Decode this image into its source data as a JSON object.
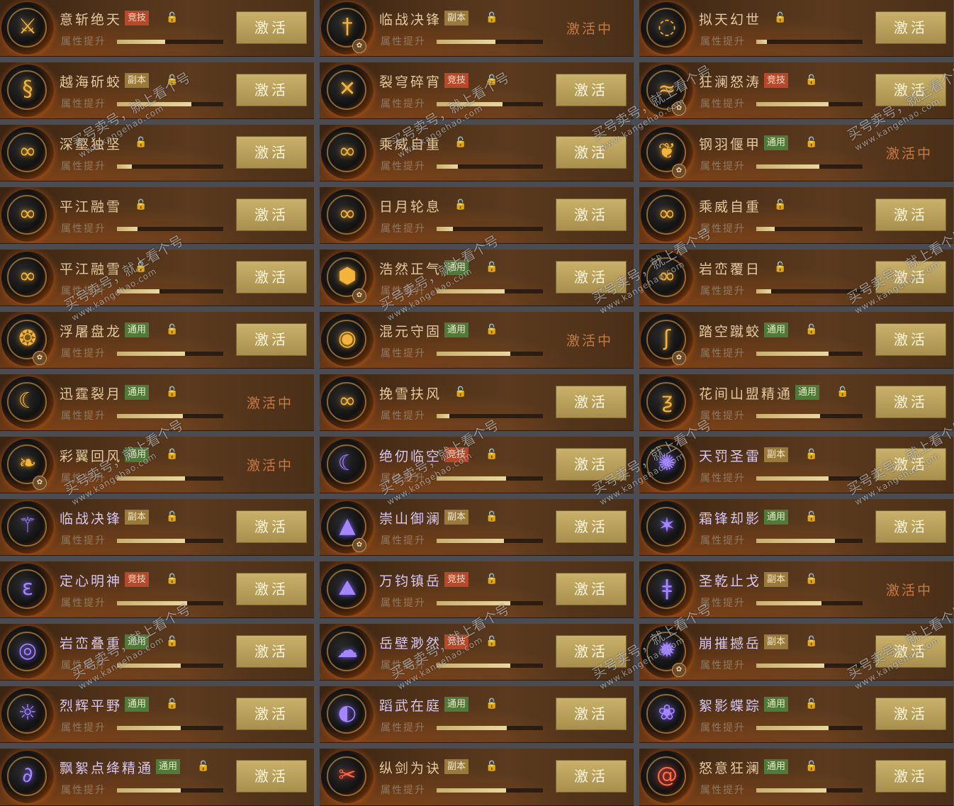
{
  "ui": {
    "attr_label": "属性提升",
    "activate_label": "激活",
    "active_label": "激活中",
    "tags": {
      "jingji": "竞技",
      "fuben": "副本",
      "tongyong": "通用"
    }
  },
  "watermark": {
    "line1": "买号卖号，就上看个号",
    "line2": "www.kangehao.com"
  },
  "rows": [
    [
      {
        "name": "意斩绝天",
        "tag": "竞技",
        "lock": true,
        "progress": 0.45,
        "state": "activate",
        "icon": "flame-sword-icon",
        "tone": "gold",
        "seal": false
      },
      {
        "name": "临战决锋",
        "tag": "副本",
        "lock": true,
        "progress": 0.55,
        "state": "active",
        "icon": "sword-hilt-icon",
        "tone": "gold",
        "seal": true
      },
      {
        "name": "拟天幻世",
        "tag": "",
        "lock": true,
        "progress": 0.1,
        "state": "activate",
        "icon": "orb-chain-icon",
        "tone": "gold",
        "seal": false
      }
    ],
    [
      {
        "name": "越海斫蛟",
        "tag": "副本",
        "lock": true,
        "progress": 0.7,
        "state": "activate",
        "icon": "dragon-icon",
        "tone": "gold",
        "seal": false
      },
      {
        "name": "裂穹碎宵",
        "tag": "竞技",
        "lock": true,
        "progress": 0.62,
        "state": "activate",
        "icon": "crossed-blades-icon",
        "tone": "gold",
        "seal": false
      },
      {
        "name": "狂澜怒涛",
        "tag": "竞技",
        "lock": true,
        "progress": 0.68,
        "state": "activate",
        "icon": "wave-icon",
        "tone": "gold",
        "seal": true
      }
    ],
    [
      {
        "name": "深壑独坚",
        "tag": "",
        "lock": true,
        "progress": 0.14,
        "state": "activate",
        "icon": "chain-icon",
        "tone": "gold",
        "seal": false
      },
      {
        "name": "乘威自重",
        "tag": "",
        "lock": true,
        "progress": 0.2,
        "state": "activate",
        "icon": "chain-icon",
        "tone": "gold",
        "seal": false
      },
      {
        "name": "钢羽偃甲",
        "tag": "通用",
        "lock": true,
        "progress": 0.59,
        "state": "active",
        "icon": "feather-icon",
        "tone": "gold",
        "seal": true
      }
    ],
    [
      {
        "name": "平江融雪",
        "tag": "",
        "lock": true,
        "progress": 0.19,
        "state": "activate",
        "icon": "chain-icon",
        "tone": "gold",
        "seal": false
      },
      {
        "name": "日月轮息",
        "tag": "",
        "lock": true,
        "progress": 0.15,
        "state": "activate",
        "icon": "chain-icon",
        "tone": "gold",
        "seal": false
      },
      {
        "name": "乘威自重",
        "tag": "",
        "lock": true,
        "progress": 0.17,
        "state": "activate",
        "icon": "chain-icon",
        "tone": "gold",
        "seal": false
      }
    ],
    [
      {
        "name": "平江融雪",
        "tag": "",
        "lock": true,
        "progress": 0.4,
        "state": "activate",
        "icon": "chain-icon",
        "tone": "gold",
        "seal": false
      },
      {
        "name": "浩然正气",
        "tag": "通用",
        "lock": true,
        "progress": 0.64,
        "state": "activate",
        "icon": "shield-icon",
        "tone": "gold",
        "seal": true
      },
      {
        "name": "岩峦覆日",
        "tag": "",
        "lock": true,
        "progress": 0.14,
        "state": "activate",
        "icon": "chain-icon",
        "tone": "gold",
        "seal": false
      }
    ],
    [
      {
        "name": "浮屠盘龙",
        "tag": "通用",
        "lock": true,
        "progress": 0.64,
        "state": "activate",
        "icon": "coiled-dragon-icon",
        "tone": "gold",
        "seal": true
      },
      {
        "name": "混元守固",
        "tag": "通用",
        "lock": true,
        "progress": 0.69,
        "state": "active",
        "icon": "orb-icon",
        "tone": "gold",
        "seal": false
      },
      {
        "name": "踏空蹴蛟",
        "tag": "通用",
        "lock": true,
        "progress": 0.68,
        "state": "activate",
        "icon": "serpent-icon",
        "tone": "gold",
        "seal": true
      }
    ],
    [
      {
        "name": "迅霆裂月",
        "tag": "通用",
        "lock": true,
        "progress": 0.62,
        "state": "active",
        "icon": "crescent-icon",
        "tone": "gold",
        "seal": false
      },
      {
        "name": "挽雪扶风",
        "tag": "",
        "lock": true,
        "progress": 0.12,
        "state": "activate",
        "icon": "chain-icon",
        "tone": "gold",
        "seal": false
      },
      {
        "name": "花间山盟精通",
        "tag": "通用",
        "lock": true,
        "progress": 0.6,
        "state": "activate",
        "icon": "flame-script-icon",
        "tone": "gold",
        "seal": false
      }
    ],
    [
      {
        "name": "彩翼回风",
        "tag": "通用",
        "lock": true,
        "progress": 0.64,
        "state": "active",
        "icon": "wing-icon",
        "tone": "gold",
        "seal": true
      },
      {
        "name": "绝仞临空",
        "tag": "竞技",
        "lock": true,
        "progress": 0.65,
        "state": "activate",
        "icon": "crescent-icon",
        "tone": "purple",
        "seal": false
      },
      {
        "name": "天罚圣雷",
        "tag": "副本",
        "lock": true,
        "progress": 0.68,
        "state": "activate",
        "icon": "storm-icon",
        "tone": "purple",
        "seal": false
      }
    ],
    [
      {
        "name": "临战决锋",
        "tag": "副本",
        "lock": true,
        "progress": 0.64,
        "state": "activate",
        "icon": "sword-icon",
        "tone": "purple",
        "seal": false
      },
      {
        "name": "崇山御澜",
        "tag": "副本",
        "lock": true,
        "progress": 0.63,
        "state": "activate",
        "icon": "mountain-icon",
        "tone": "purple",
        "seal": true
      },
      {
        "name": "霜锋却影",
        "tag": "通用",
        "lock": true,
        "progress": 0.74,
        "state": "activate",
        "icon": "star-burst-icon",
        "tone": "purple",
        "seal": false
      }
    ],
    [
      {
        "name": "定心明神",
        "tag": "竞技",
        "lock": true,
        "progress": 0.66,
        "state": "activate",
        "icon": "swirl-icon",
        "tone": "purple",
        "seal": false
      },
      {
        "name": "万钧镇岳",
        "tag": "竞技",
        "lock": true,
        "progress": 0.69,
        "state": "activate",
        "icon": "peak-icon",
        "tone": "purple",
        "seal": false
      },
      {
        "name": "圣乾止戈",
        "tag": "副本",
        "lock": true,
        "progress": 0.61,
        "state": "active",
        "icon": "halberd-icon",
        "tone": "purple",
        "seal": false
      }
    ],
    [
      {
        "name": "岩峦叠重",
        "tag": "通用",
        "lock": true,
        "progress": 0.6,
        "state": "activate",
        "icon": "eye-icon",
        "tone": "purple",
        "seal": false
      },
      {
        "name": "岳壁渺然",
        "tag": "竞技",
        "lock": true,
        "progress": 0.69,
        "state": "activate",
        "icon": "cloud-icon",
        "tone": "purple",
        "seal": false
      },
      {
        "name": "崩摧撼岳",
        "tag": "副本",
        "lock": true,
        "progress": 0.64,
        "state": "activate",
        "icon": "burst-icon",
        "tone": "purple",
        "seal": true
      }
    ],
    [
      {
        "name": "烈辉平野",
        "tag": "通用",
        "lock": true,
        "progress": 0.6,
        "state": "activate",
        "icon": "sun-ring-icon",
        "tone": "purple",
        "seal": false
      },
      {
        "name": "蹈武在庭",
        "tag": "通用",
        "lock": true,
        "progress": 0.66,
        "state": "activate",
        "icon": "vortex-icon",
        "tone": "purple",
        "seal": false
      },
      {
        "name": "絮影蝶踪",
        "tag": "通用",
        "lock": true,
        "progress": 0.68,
        "state": "activate",
        "icon": "butterfly-icon",
        "tone": "purple",
        "seal": false
      }
    ],
    [
      {
        "name": "飘絮点绛精通",
        "tag": "通用",
        "lock": true,
        "progress": 0.6,
        "state": "activate",
        "icon": "ribbon-icon",
        "tone": "purple",
        "seal": false
      },
      {
        "name": "纵剑为诀",
        "tag": "副本",
        "lock": true,
        "progress": 0.65,
        "state": "activate",
        "icon": "blades-icon",
        "tone": "red",
        "seal": false
      },
      {
        "name": "怒意狂澜",
        "tag": "通用",
        "lock": true,
        "progress": 0.66,
        "state": "activate",
        "icon": "spiral-icon",
        "tone": "red",
        "seal": false
      }
    ]
  ],
  "glyphs": {
    "flame-sword-icon": "⚔",
    "sword-hilt-icon": "†",
    "orb-chain-icon": "◌",
    "dragon-icon": "§",
    "crossed-blades-icon": "✕",
    "wave-icon": "≈",
    "chain-icon": "∞",
    "feather-icon": "❦",
    "shield-icon": "⬢",
    "coiled-dragon-icon": "❂",
    "orb-icon": "◉",
    "serpent-icon": "ʃ",
    "crescent-icon": "☾",
    "flame-script-icon": "ƺ",
    "wing-icon": "❧",
    "storm-icon": "✺",
    "sword-icon": "⚚",
    "mountain-icon": "▲",
    "star-burst-icon": "✶",
    "swirl-icon": "ε",
    "peak-icon": "⛰",
    "halberd-icon": "ǂ",
    "eye-icon": "◎",
    "cloud-icon": "☁",
    "burst-icon": "✹",
    "sun-ring-icon": "☼",
    "vortex-icon": "◐",
    "butterfly-icon": "❀",
    "ribbon-icon": "∂",
    "blades-icon": "✂",
    "spiral-icon": "@"
  }
}
